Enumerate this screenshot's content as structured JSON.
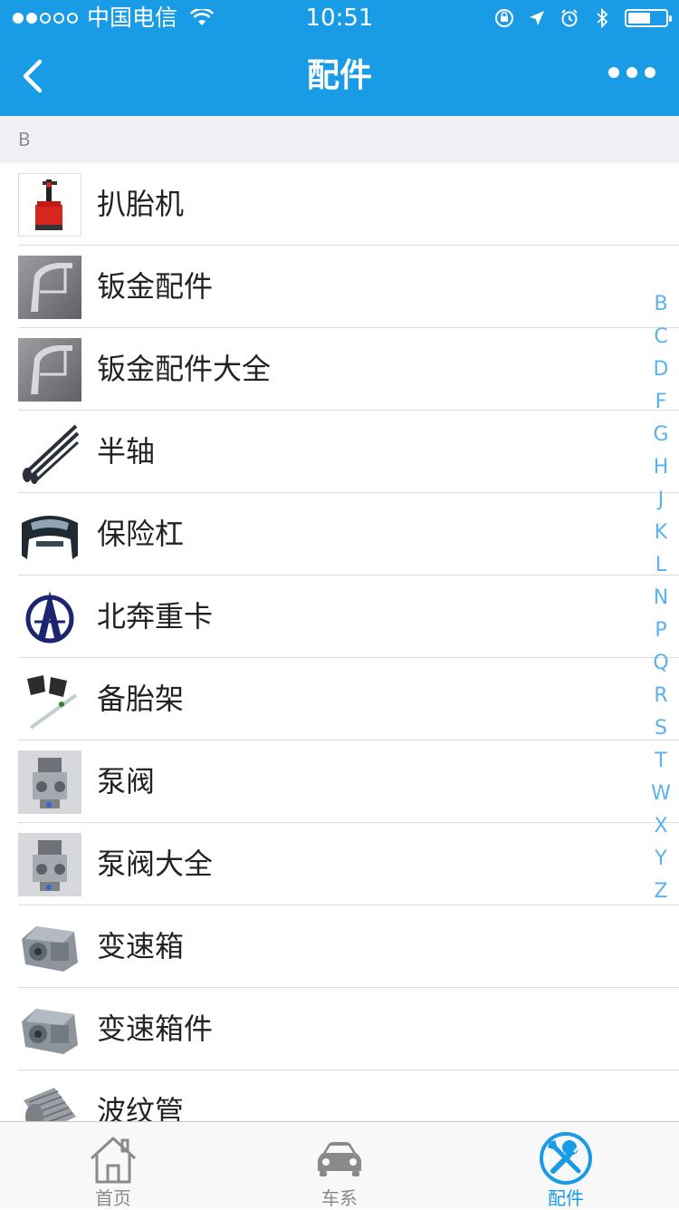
{
  "status_bar": {
    "carrier": "中国电信",
    "time": "10:51",
    "signal_dots_filled": 2,
    "signal_dots_total": 5,
    "battery_level": 0.6
  },
  "nav": {
    "title": "配件",
    "back_icon": "chevron-left-icon",
    "more_icon": "more-dots-icon"
  },
  "section": {
    "letter": "B"
  },
  "items": [
    {
      "label": "扒胎机",
      "icon": "tire-changer-thumb"
    },
    {
      "label": "钣金配件",
      "icon": "sheet-metal-thumb"
    },
    {
      "label": "钣金配件大全",
      "icon": "sheet-metal-thumb"
    },
    {
      "label": "半轴",
      "icon": "half-shaft-thumb"
    },
    {
      "label": "保险杠",
      "icon": "bumper-thumb"
    },
    {
      "label": "北奔重卡",
      "icon": "beiben-logo-thumb"
    },
    {
      "label": "备胎架",
      "icon": "spare-tire-carrier-thumb"
    },
    {
      "label": "泵阀",
      "icon": "pump-valve-thumb"
    },
    {
      "label": "泵阀大全",
      "icon": "pump-valve-thumb"
    },
    {
      "label": "变速箱",
      "icon": "gearbox-thumb"
    },
    {
      "label": "变速箱件",
      "icon": "gearbox-thumb"
    },
    {
      "label": "波纹管",
      "icon": "bellows-thumb"
    }
  ],
  "index_letters": [
    "B",
    "C",
    "D",
    "F",
    "G",
    "H",
    "J",
    "K",
    "L",
    "N",
    "P",
    "Q",
    "R",
    "S",
    "T",
    "W",
    "X",
    "Y",
    "Z"
  ],
  "tabs": [
    {
      "label": "首页",
      "icon": "home-icon",
      "active": false
    },
    {
      "label": "车系",
      "icon": "car-icon",
      "active": false
    },
    {
      "label": "配件",
      "icon": "tools-icon",
      "active": true
    }
  ],
  "colors": {
    "primary": "#1a9be6",
    "index": "#5ab2ee",
    "inactive_tab": "#8a8a8a"
  }
}
